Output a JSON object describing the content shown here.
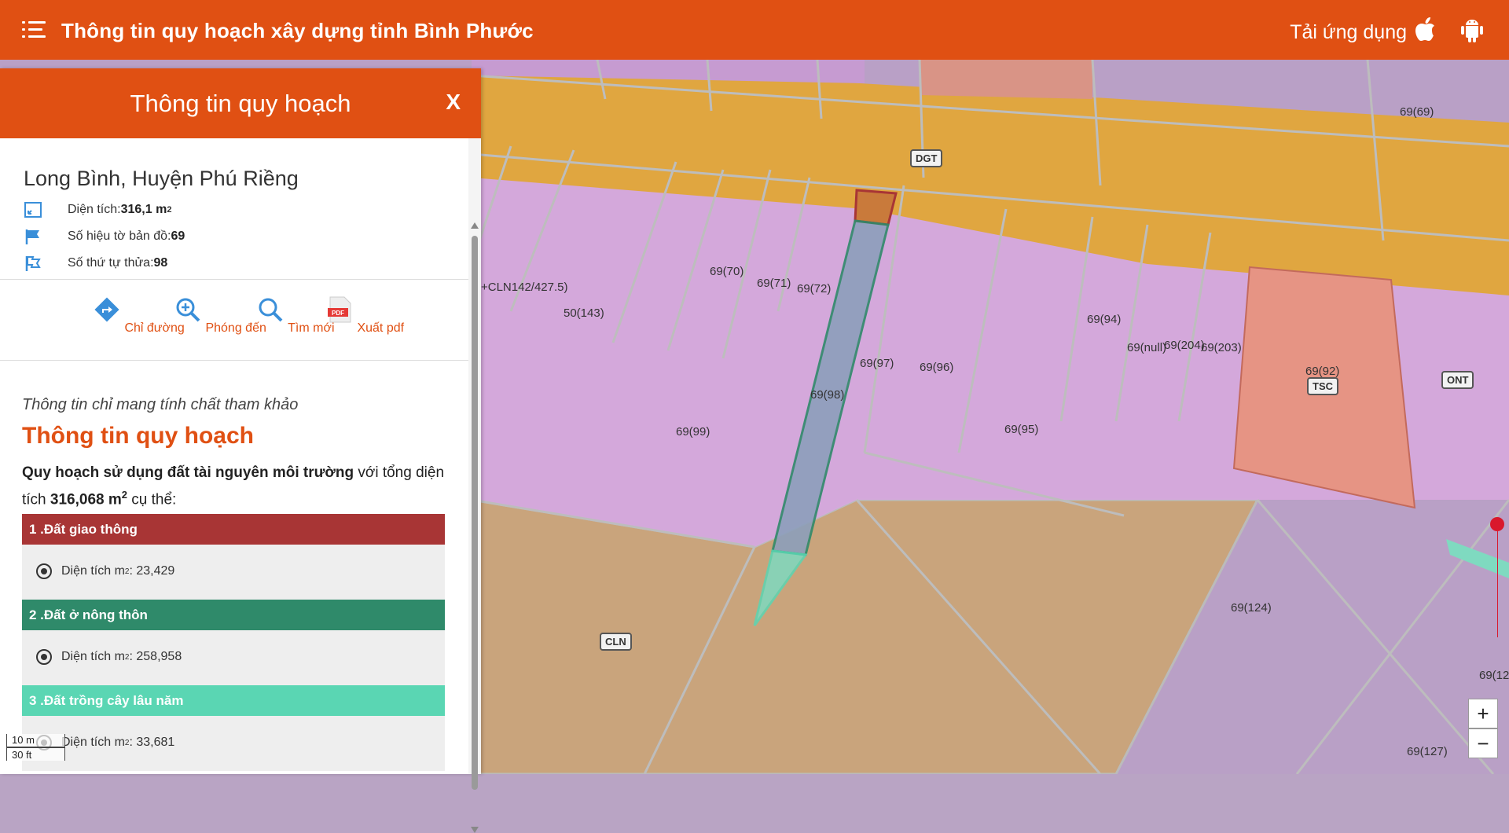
{
  "app": {
    "title": "Thông tin quy hoạch xây dựng tỉnh Bình Phước",
    "download_label": "Tải ứng dụng"
  },
  "panel": {
    "title": "Thông tin quy hoạch",
    "close_label": "X",
    "location": "Long Bình, Huyện Phú Riềng",
    "area_label": "Diện tích: ",
    "area_value": "316,1 m",
    "area_unit_sup": "2",
    "map_sheet_label": "Số hiệu tờ bản đồ: ",
    "map_sheet_value": "69",
    "parcel_label": "Số thứ tự thửa: ",
    "parcel_value": "98",
    "actions": [
      {
        "label": "Chỉ đường",
        "icon": "directions-icon"
      },
      {
        "label": "Phóng đến",
        "icon": "zoom-in-icon"
      },
      {
        "label": "Tìm mới",
        "icon": "search-icon"
      },
      {
        "label": "Xuất pdf",
        "icon": "pdf-icon"
      }
    ],
    "note": "Thông tin chỉ mang tính chất tham khảo",
    "section_title": "Thông tin quy hoạch",
    "summary_bold": "Quy hoạch sử dụng đất tài nguyên môi trường",
    "summary_mid": " với tổng diện tích ",
    "summary_total": "316,068 m",
    "summary_sup": "2",
    "summary_end": " cụ thể:",
    "categories": [
      {
        "title": "1 .Đất giao thông",
        "color": "#a83535",
        "item_label": "Diện tích m",
        "item_sup": "2",
        "item_value": ": 23,429"
      },
      {
        "title": "2 .Đất ở nông thôn",
        "color": "#2f8a6a",
        "item_label": "Diện tích m",
        "item_sup": "2",
        "item_value": ": 258,958"
      },
      {
        "title": "3 .Đất trồng cây lâu năm",
        "color": "#5ad6b3",
        "item_label": "Diện tích m",
        "item_sup": "2",
        "item_value": ": 33,681"
      }
    ]
  },
  "map": {
    "parcel_labels": [
      "69(69)",
      "+CLN142/427.5)",
      "50(143)",
      "69(70)",
      "69(71)",
      "69(72)",
      "69(94)",
      "69(null)",
      "69(204)",
      "69(203)",
      "69(92)",
      "69(97)",
      "69(96)",
      "69(98)",
      "69(99)",
      "69(95)",
      "69(124)",
      "69(12",
      "69(127)"
    ],
    "zone_tags": [
      "DGT",
      "TSC",
      "ONT",
      "CLN"
    ],
    "scale_m": "10 m",
    "scale_ft": "30 ft",
    "zoom_in": "+",
    "zoom_out": "−",
    "colors": {
      "road": "#e8a63a",
      "residential": "#c9a0d8",
      "perennial": "#d1a877",
      "public": "#e9968a",
      "accent": "#e05013"
    }
  }
}
